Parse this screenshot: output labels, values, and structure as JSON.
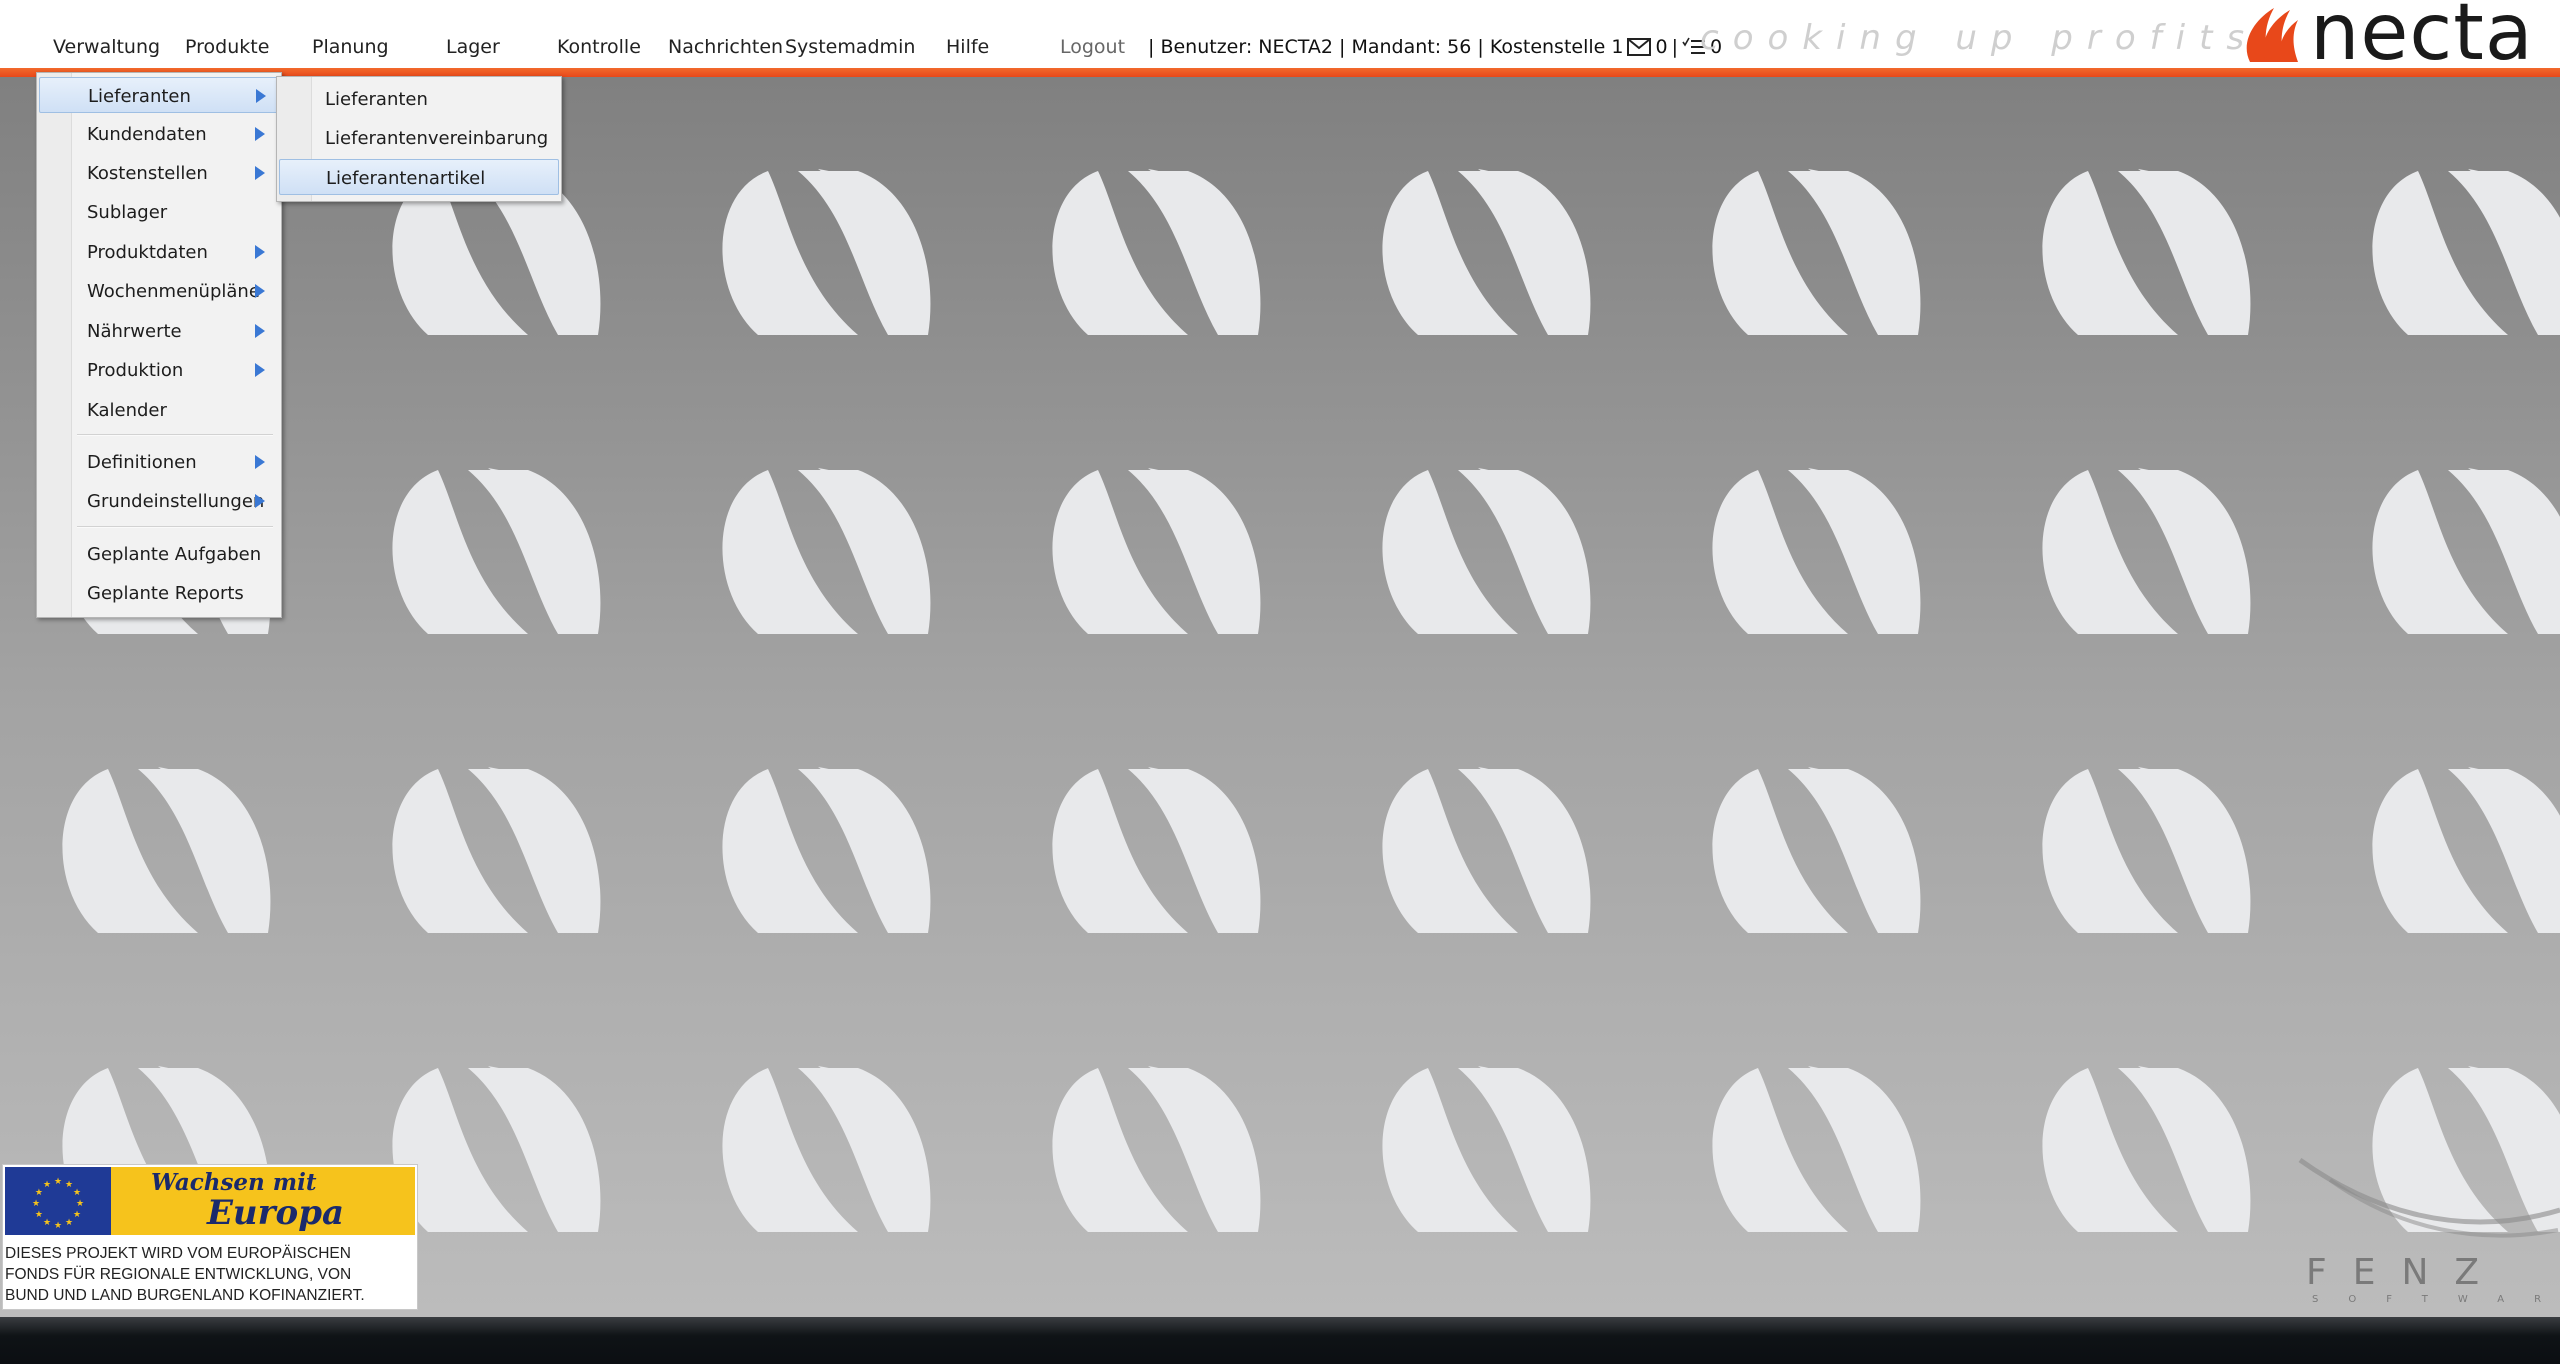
{
  "menu": [
    {
      "label": "Verwaltung"
    },
    {
      "label": "Produkte"
    },
    {
      "label": "Planung"
    },
    {
      "label": "Lager"
    },
    {
      "label": "Kontrolle"
    },
    {
      "label": "Nachrichten"
    },
    {
      "label": "Systemadmin"
    },
    {
      "label": "Hilfe"
    },
    {
      "label": "Logout"
    }
  ],
  "status": {
    "text": "| Benutzer: NECTA2 | Mandant: 56 | Kostenstelle 1",
    "mail_count": "0",
    "sep": "|",
    "task_count": "0",
    "mail_icon": "envelope-icon",
    "task_icon": "task-list-icon"
  },
  "slogan": "cooking up profits",
  "logo": {
    "text": "necta",
    "icon": "necta-flame-icon",
    "color": "#e8481a"
  },
  "dropdown": {
    "items": [
      {
        "label": "Lieferanten",
        "submenu": true,
        "highlighted": true
      },
      {
        "label": "Kundendaten",
        "submenu": true
      },
      {
        "label": "Kostenstellen",
        "submenu": true
      },
      {
        "label": "Sublager",
        "submenu": false
      },
      {
        "label": "Produktdaten",
        "submenu": true
      },
      {
        "label": "Wochenmenüpläne",
        "submenu": true
      },
      {
        "label": "Nährwerte",
        "submenu": true
      },
      {
        "label": "Produktion",
        "submenu": true
      },
      {
        "label": "Kalender",
        "submenu": false
      },
      {
        "label": "Definitionen",
        "submenu": true
      },
      {
        "label": "Grundeinstellungen",
        "submenu": true
      },
      {
        "label": "Geplante Aufgaben",
        "submenu": false
      },
      {
        "label": "Geplante Reports",
        "submenu": false
      }
    ]
  },
  "submenu": {
    "items": [
      {
        "label": "Lieferanten"
      },
      {
        "label": "Lieferantenvereinbarung"
      },
      {
        "label": "Lieferantenartikel",
        "highlighted": true
      }
    ]
  },
  "eu_banner": {
    "line1": "Wachsen mit",
    "line2": "Europa",
    "text_lines": [
      "DIESES PROJEKT WIRD  VOM EUROPÄISCHEN",
      "FONDS FÜR REGIONALE ENTWICKLUNG,  VON",
      "BUND UND LAND BURGENLAND KOFINANZIERT."
    ]
  },
  "fenz": {
    "title": "FENZ",
    "subtitle": "SOFTWARE"
  },
  "colors": {
    "accent": "#e8481a",
    "highlight": "#cfe0f5",
    "arrow": "#3a78d4"
  }
}
